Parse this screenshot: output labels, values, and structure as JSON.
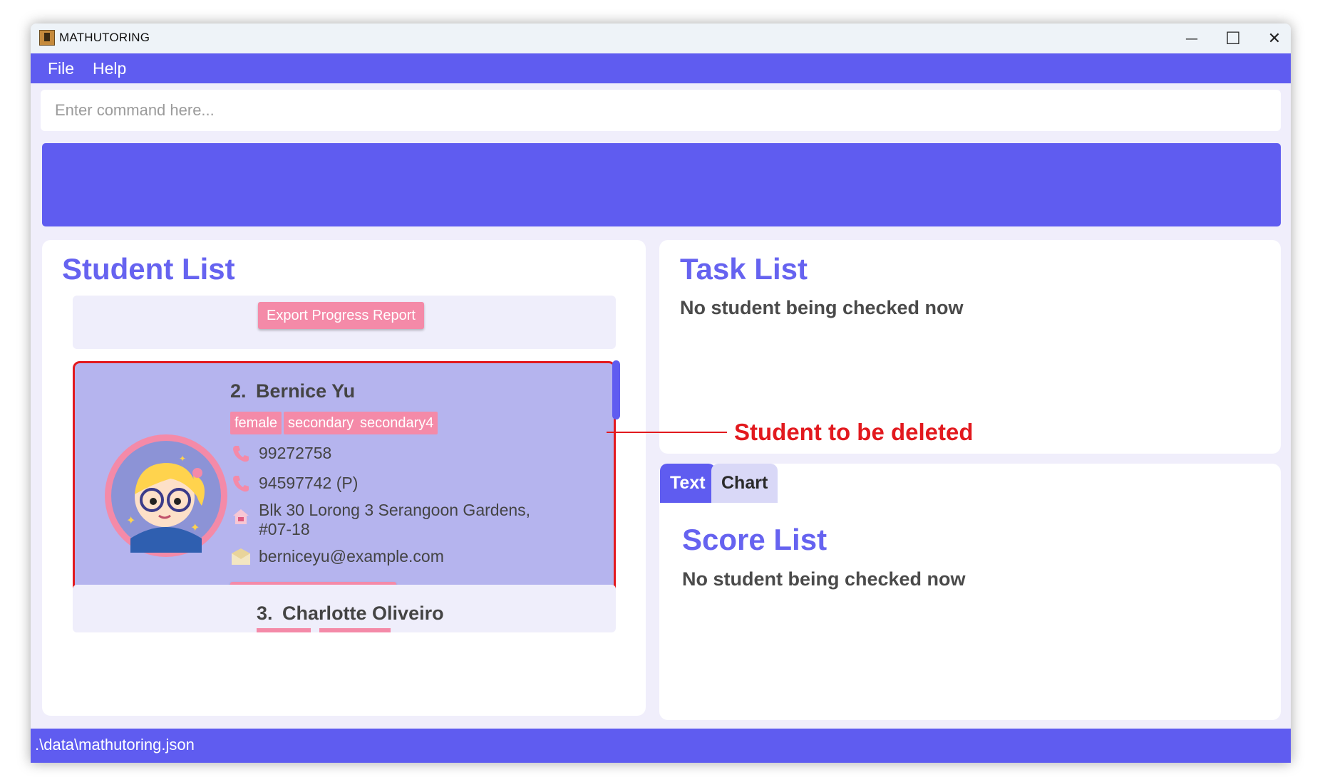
{
  "window": {
    "title": "MATHUTORING",
    "minimize_glyph": "—",
    "maximize_glyph": "☐",
    "close_glyph": "✕"
  },
  "menu": {
    "file": "File",
    "help": "Help"
  },
  "command": {
    "placeholder": "Enter command here..."
  },
  "student_list": {
    "title": "Student List",
    "export_label": "Export Progress Report",
    "selected": {
      "index": "2.",
      "name": "Bernice Yu",
      "tags": [
        "female",
        "secondary",
        "secondary4"
      ],
      "phone": "99272758",
      "parent_phone": "94597742 (P)",
      "address_line1": "Blk 30 Lorong 3 Serangoon Gardens,",
      "address_line2": "#07-18",
      "email": "berniceyu@example.com"
    },
    "next": {
      "index": "3.",
      "name": "Charlotte Oliveiro"
    }
  },
  "task_list": {
    "title": "Task List",
    "subtitle": "No student being checked now"
  },
  "tabs": {
    "text": "Text",
    "chart": "Chart"
  },
  "score_list": {
    "title": "Score List",
    "subtitle": "No student being checked now"
  },
  "status": {
    "path": ".\\data\\mathutoring.json"
  },
  "annotation": {
    "text": "Student to be deleted"
  },
  "colors": {
    "accent": "#5f5cf0",
    "tag": "#f48aa8",
    "highlight": "#e2191e",
    "title": "#6663f0"
  },
  "icons": [
    "app-icon",
    "minimize-icon",
    "maximize-icon",
    "close-icon",
    "phone-icon",
    "house-icon",
    "envelope-icon",
    "avatar"
  ]
}
